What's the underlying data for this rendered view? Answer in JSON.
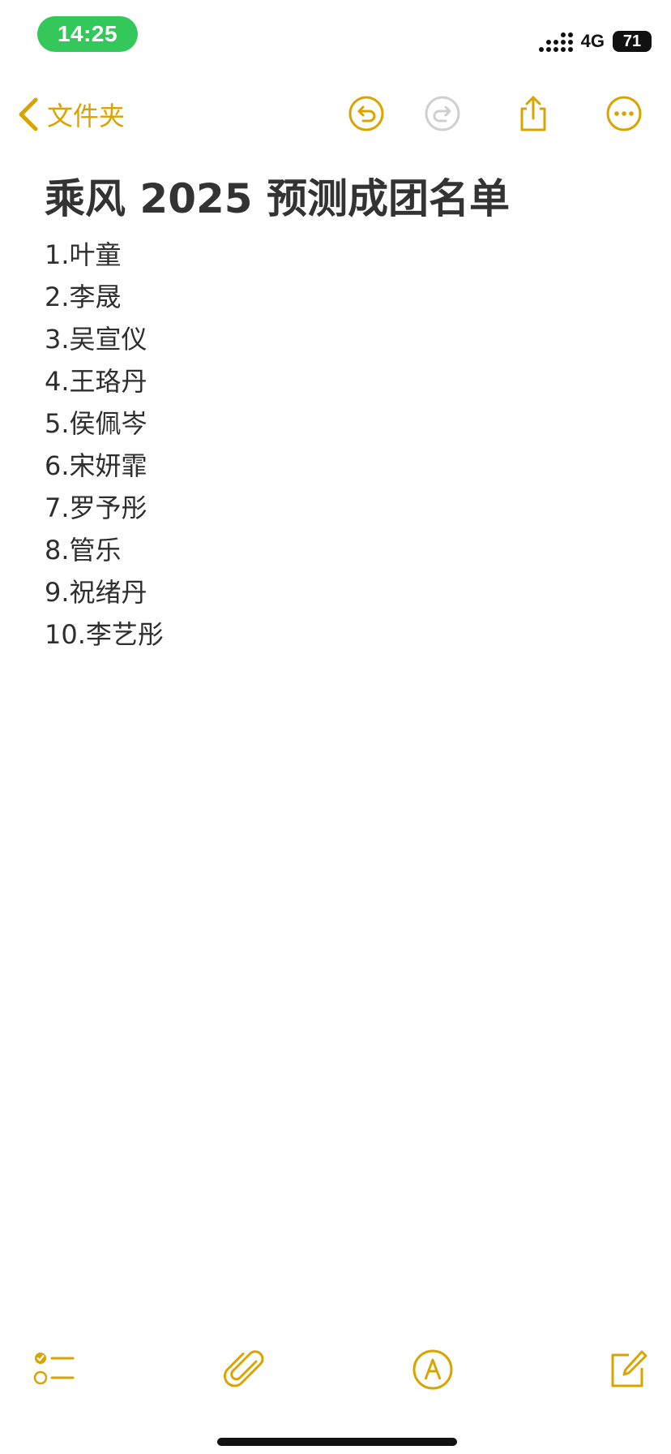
{
  "status_bar": {
    "time": "14:25",
    "network": "4G",
    "battery": "71"
  },
  "nav": {
    "back_label": "文件夹"
  },
  "note": {
    "title": "乘风 2025 预测成团名单",
    "items": [
      "1.叶童",
      "2.李晟",
      "3.吴宣仪",
      "4.王珞丹",
      "5.侯佩岑",
      "6.宋妍霏",
      "7.罗予彤",
      "8.管乐",
      "9.祝绪丹",
      "10.李艺彤"
    ]
  },
  "icons": {
    "accent_color": "#d9a400",
    "nav": [
      "chevron-left-icon",
      "undo-icon",
      "redo-icon",
      "share-icon",
      "more-icon"
    ],
    "toolbar": [
      "checklist-icon",
      "paperclip-icon",
      "markup-icon",
      "compose-icon"
    ]
  }
}
